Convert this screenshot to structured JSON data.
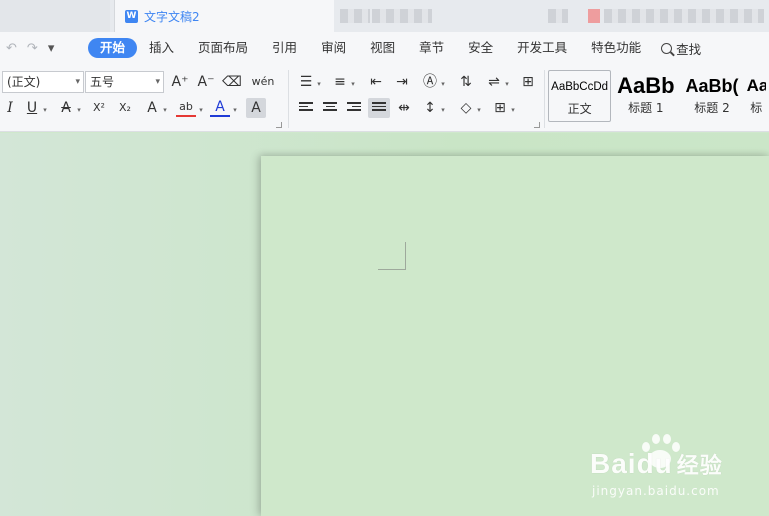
{
  "titlebar": {
    "doc_title": "文字文稿2",
    "doc_icon": "W"
  },
  "quick_access": {
    "undo_icon": "↶",
    "redo_icon": "↷",
    "more_icon": "▾"
  },
  "menu": {
    "items": [
      "开始",
      "插入",
      "页面布局",
      "引用",
      "审阅",
      "视图",
      "章节",
      "安全",
      "开发工具",
      "特色功能"
    ],
    "active": "开始",
    "search_label": "查找"
  },
  "ribbon": {
    "font_name": "(正文)",
    "font_size": "五号",
    "grow_font": "A⁺",
    "shrink_font": "A⁻",
    "clear_format": "⌫",
    "phonetic": "wén",
    "italic": "I",
    "underline": "U",
    "strike": "A",
    "superscript": "X²",
    "subscript": "X₂",
    "text_effect": "A",
    "highlight": "ab",
    "font_color": "A",
    "char_shade": "A"
  },
  "styles": [
    {
      "sample": "AaBbCcDd",
      "label": "正文"
    },
    {
      "sample": "AaBb",
      "label": "标题 1"
    },
    {
      "sample": "AaBb(",
      "label": "标题 2"
    },
    {
      "sample": "Aa",
      "label": "标"
    }
  ],
  "watermark": {
    "brand": "Baidu",
    "suffix": "经验",
    "url": "jingyan.baidu.com"
  },
  "colors": {
    "accent": "#3f86f2",
    "page_bg": "#cfe8cb",
    "font_color_bar": "#1f3bd6",
    "highlight_bar": "#e53935"
  }
}
